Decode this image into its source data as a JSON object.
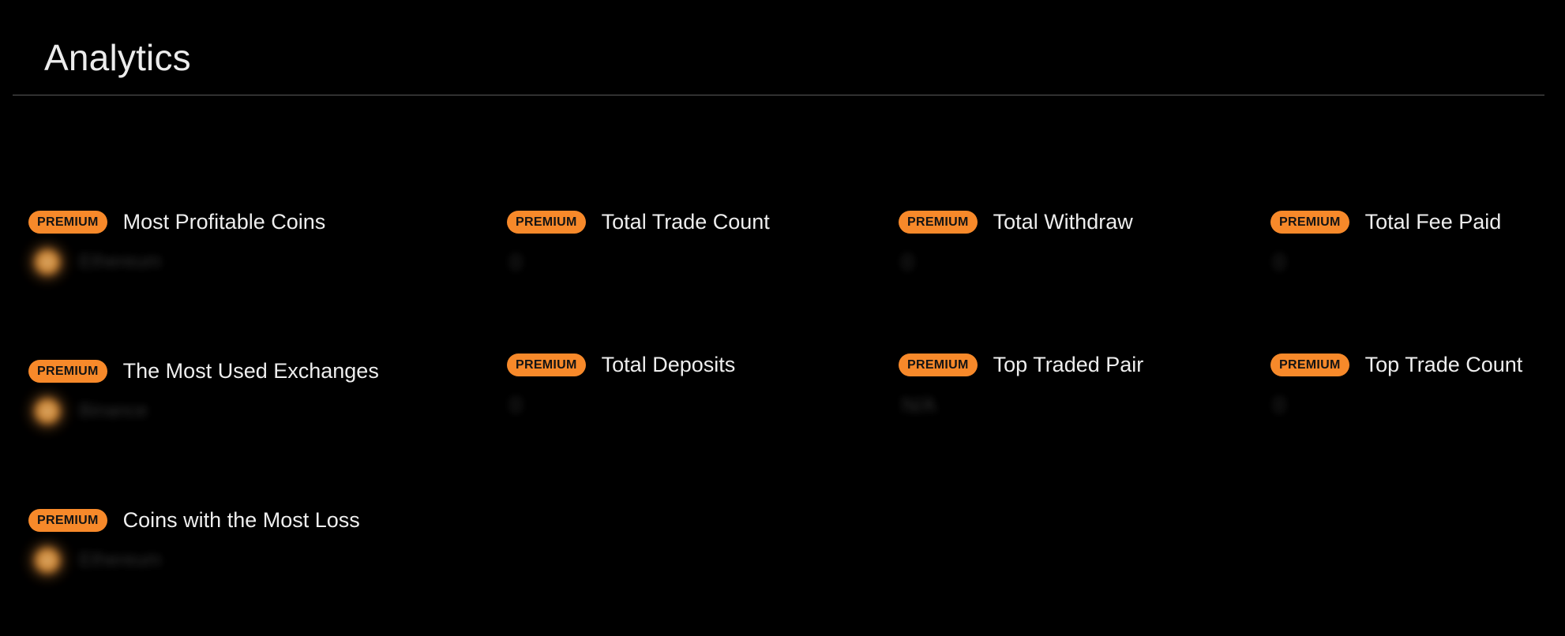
{
  "page": {
    "title": "Analytics"
  },
  "badge_label": "PREMIUM",
  "colors": {
    "background": "#000000",
    "accent": "#f7892a",
    "divider": "#5a5a5a",
    "text": "#eeeeee"
  },
  "cards": {
    "most_profitable_coins": {
      "title": "Most Profitable Coins",
      "icon": "coin-icon",
      "value": "Ethereum"
    },
    "total_trade_count": {
      "title": "Total Trade Count",
      "value": "0"
    },
    "total_withdraw": {
      "title": "Total Withdraw",
      "value": "0"
    },
    "total_fee_paid": {
      "title": "Total Fee Paid",
      "value": "0"
    },
    "most_used_exchanges": {
      "title": "The Most Used Exchanges",
      "icon": "exchange-icon",
      "value": "Binance"
    },
    "total_deposits": {
      "title": "Total Deposits",
      "value": "0"
    },
    "top_traded_pair": {
      "title": "Top Traded Pair",
      "value": "N/A"
    },
    "top_trade_count": {
      "title": "Top Trade Count",
      "value": "0"
    },
    "coins_most_loss": {
      "title": "Coins with the Most Loss",
      "icon": "coin-icon",
      "value": "Ethereum"
    }
  }
}
